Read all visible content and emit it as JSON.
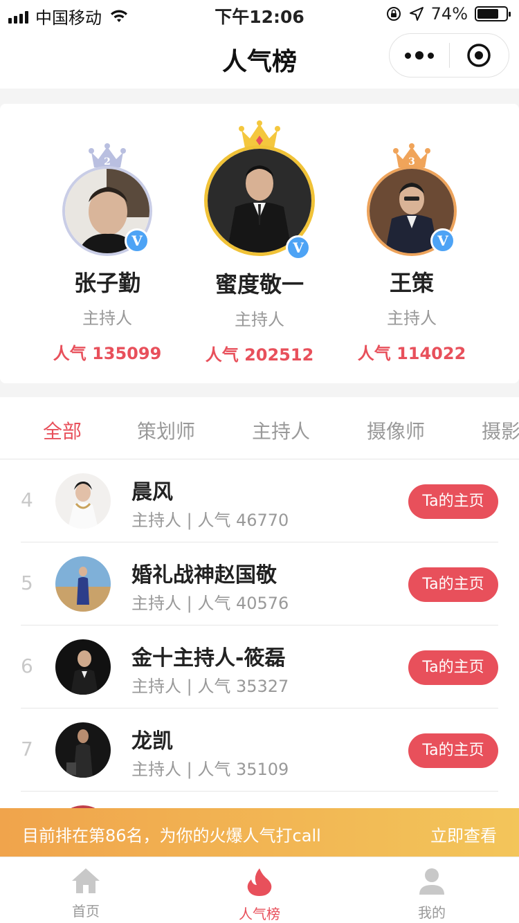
{
  "status_bar": {
    "carrier": "中国移动",
    "time": "下午12:06",
    "battery_text": "74%",
    "battery_level": 0.74
  },
  "nav": {
    "title": "人气榜"
  },
  "podium": [
    {
      "rank": "2",
      "name": "张子勤",
      "role": "主持人",
      "popularity": "人气 135099",
      "verified": "V",
      "crown_color": "#b9bfe0",
      "ring_color": "#c9cde6"
    },
    {
      "rank": "1",
      "name": "蜜度敬一",
      "role": "主持人",
      "popularity": "人气 202512",
      "verified": "V",
      "crown_color": "#f4c73e",
      "ring_color": "#f0c237"
    },
    {
      "rank": "3",
      "name": "王策",
      "role": "主持人",
      "popularity": "人气 114022",
      "verified": "V",
      "crown_color": "#f0a45a",
      "ring_color": "#eda35b"
    }
  ],
  "tabs": [
    {
      "label": "全部",
      "active": true
    },
    {
      "label": "策划师",
      "active": false
    },
    {
      "label": "主持人",
      "active": false
    },
    {
      "label": "摄像师",
      "active": false
    },
    {
      "label": "摄影师",
      "active": false
    }
  ],
  "list": [
    {
      "rank": "4",
      "name": "晨风",
      "meta": "主持人 | 人气 46770",
      "button": "Ta的主页"
    },
    {
      "rank": "5",
      "name": "婚礼战神赵国敬",
      "meta": "主持人 | 人气 40576",
      "button": "Ta的主页"
    },
    {
      "rank": "6",
      "name": "金十主持人-筱磊",
      "meta": "主持人 | 人气 35327",
      "button": "Ta的主页"
    },
    {
      "rank": "7",
      "name": "龙凯",
      "meta": "主持人 | 人气 35109",
      "button": "Ta的主页"
    }
  ],
  "promo": {
    "text": "目前排在第86名，为你的火爆人气打call",
    "link": "立即查看"
  },
  "tabbar": [
    {
      "label": "首页",
      "icon": "home-icon",
      "active": false
    },
    {
      "label": "人气榜",
      "icon": "flame-icon",
      "active": true
    },
    {
      "label": "我的",
      "icon": "user-icon",
      "active": false
    }
  ],
  "colors": {
    "accent": "#e8505b",
    "promo_start": "#f0a44c",
    "promo_end": "#f3c55a",
    "verified": "#4da3f5"
  }
}
